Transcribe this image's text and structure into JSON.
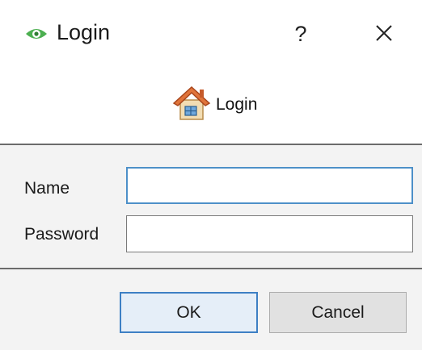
{
  "window": {
    "title": "Login",
    "help_label": "?",
    "icons": {
      "app": "eye-icon",
      "close": "close-icon"
    }
  },
  "header": {
    "icon": "house-icon",
    "label": "Login"
  },
  "form": {
    "name_label": "Name",
    "name_value": "",
    "password_label": "Password",
    "password_value": ""
  },
  "buttons": {
    "ok_label": "OK",
    "cancel_label": "Cancel"
  },
  "colors": {
    "focus_accent": "#3d7fc4",
    "eye_icon": "#4caf50",
    "house_roof": "#e0743a"
  }
}
